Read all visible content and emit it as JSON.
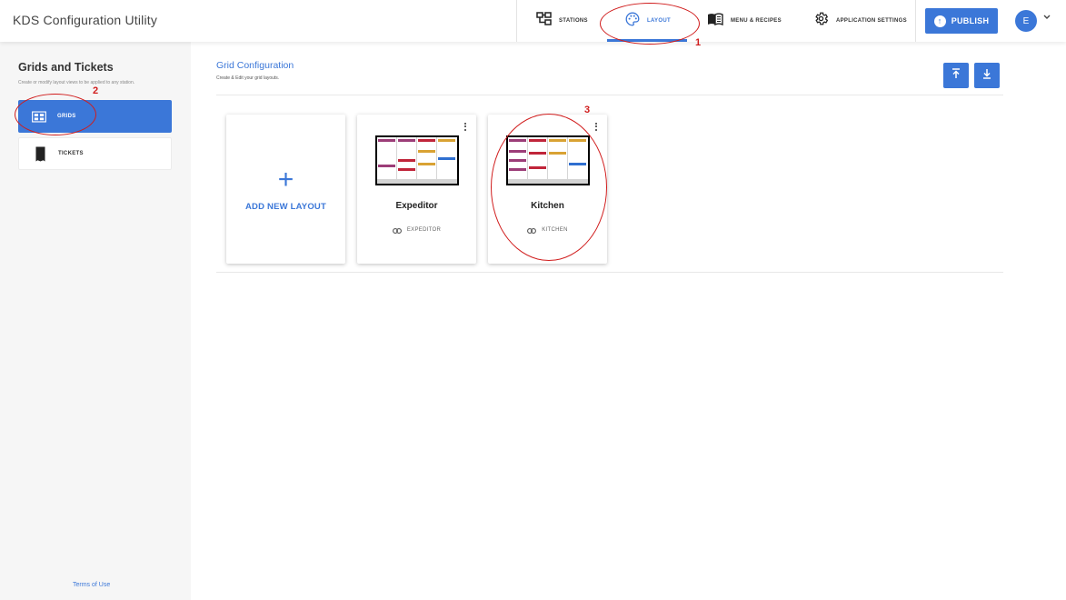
{
  "app": {
    "title": "KDS Configuration Utility"
  },
  "nav": {
    "tabs": [
      {
        "label": "STATIONS",
        "icon": "stations-icon"
      },
      {
        "label": "LAYOUT",
        "icon": "palette-icon",
        "active": true
      },
      {
        "label": "MENU & RECIPES",
        "icon": "book-icon"
      },
      {
        "label": "APPLICATION SETTINGS",
        "icon": "gear-icon"
      }
    ],
    "publish_label": "PUBLISH",
    "avatar_initial": "E"
  },
  "sidebar": {
    "title": "Grids and Tickets",
    "subtitle": "Create or modify layout views to be applied to any station.",
    "items": [
      {
        "label": "GRIDS",
        "icon": "grid-icon",
        "active": true
      },
      {
        "label": "TICKETS",
        "icon": "ticket-icon"
      }
    ],
    "terms_label": "Terms of Use"
  },
  "main": {
    "title": "Grid Configuration",
    "subtitle": "Create & Edit your grid layouts.",
    "upload_icon": "upload-icon",
    "download_icon": "download-icon",
    "add_card_label": "ADD NEW LAYOUT",
    "layouts": [
      {
        "name": "Expeditor",
        "linked_station": "EXPEDITOR"
      },
      {
        "name": "Kitchen",
        "linked_station": "KITCHEN"
      }
    ]
  },
  "annotations": [
    "1",
    "2",
    "3"
  ],
  "colors": {
    "accent": "#3b77d8",
    "annotation": "#d01c1c",
    "thumb_purple": "#9c3d78",
    "thumb_red": "#c0253a",
    "thumb_gold": "#d9a233",
    "thumb_blue": "#2f6fd0"
  }
}
